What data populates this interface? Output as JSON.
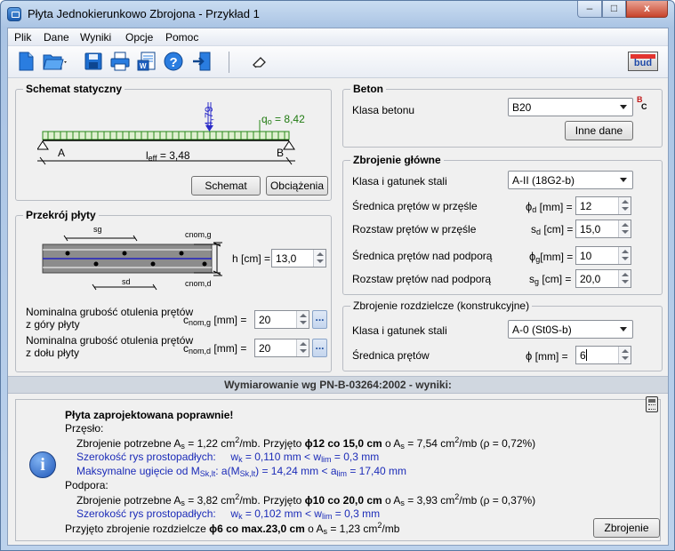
{
  "window": {
    "title": "Płyta Jednokierunkowo Zbrojona - Przykład 1",
    "min": "–",
    "max": "□",
    "close": "x"
  },
  "menu": [
    "Plik",
    "Dane",
    "Wyniki",
    "Opcje",
    "Pomoc"
  ],
  "toolbar": {
    "logo": "bud"
  },
  "schemat": {
    "title": "Schemat statyczny",
    "load_point": "4,79",
    "q0_label": "q",
    "q0_sub": "o",
    "q0_value": "= 8,42",
    "support_a": "A",
    "support_b": "B",
    "leff_label": "l",
    "leff_sub": "eff",
    "leff_value": "= 3,48",
    "btn_schemat": "Schemat",
    "btn_obciazenia": "Obciążenia"
  },
  "przekroj": {
    "title": "Przekrój płyty",
    "sg": "sg",
    "sd": "sd",
    "cnomg": "cnom,g",
    "cnomd": "cnom,d",
    "h_label": "h [cm] =",
    "h_value": "13,0",
    "otul_g_l1": "Nominalna grubość otulenia prętów",
    "otul_g_l2": "z góry płyty",
    "otul_g_sym": "c",
    "otul_g_sub": "nom,g",
    "otul_g_unit": "[mm] =",
    "otul_g_value": "20",
    "otul_d_l1": "Nominalna grubość otulenia prętów",
    "otul_d_l2": "z dołu płyty",
    "otul_d_sym": "c",
    "otul_d_sub": "nom,d",
    "otul_d_unit": "[mm] =",
    "otul_d_value": "20",
    "dots": "..."
  },
  "beton": {
    "title": "Beton",
    "klasa_label": "Klasa betonu",
    "klasa_value": "B20",
    "btn_inne": "Inne dane",
    "icon_b": "B",
    "icon_c": "C"
  },
  "zbrojenie": {
    "title": "Zbrojenie główne",
    "klasa_label": "Klasa i gatunek stali",
    "klasa_value": "A-II (18G2-b)",
    "rows": [
      {
        "label": "Średnica prętów w przęśle",
        "sym": "ϕ",
        "sub": "d",
        "unit": "[mm] =",
        "value": "12"
      },
      {
        "label": "Rozstaw prętów w przęśle",
        "sym": "s",
        "sub": "d",
        "unit": "[cm] =",
        "value": "15,0"
      },
      {
        "label": "Średnica prętów nad podporą",
        "sym": "ϕ",
        "sub": "g",
        "unit": "[mm] =",
        "value": "10"
      },
      {
        "label": "Rozstaw prętów nad podporą",
        "sym": "s",
        "sub": "g",
        "unit": "[cm] =",
        "value": "20,0"
      }
    ]
  },
  "rozdz": {
    "title": "Zbrojenie rozdzielcze (konstrukcyjne)",
    "klasa_label": "Klasa i gatunek stali",
    "klasa_value": "A-0 (St0S-b)",
    "sred_label": "Średnica prętów",
    "sred_sym": "ϕ",
    "sred_unit": "[mm] =",
    "sred_value": "6"
  },
  "results": {
    "header": "Wymiarowanie wg PN-B-03264:2002 - wyniki:",
    "status": "Płyta zaprojektowana poprawnie!",
    "przeslo": "Przęsło:",
    "p1a": "Zbrojenie potrzebne A",
    "p1b": "s",
    "p1c": " = 1,22 cm",
    "p1d": "2",
    "p1e": "/mb.  Przyjęto ",
    "p1f": "ϕ12 co 15,0 cm",
    "p1g": " o A",
    "p1h": "s",
    "p1i": " = 7,54 cm",
    "p1j": "2",
    "p1k": "/mb   (ρ = 0,72%)",
    "p2a": "Szerokość rys prostopadłych:",
    "p2b": "w",
    "p2c": "k",
    "p2d": " = 0,110 mm  <  w",
    "p2e": "lim",
    "p2f": " = 0,3 mm",
    "p3a": "Maksymalne ugięcie od M",
    "p3b": "Sk,lt",
    "p3c": ":    a(M",
    "p3d": "Sk,lt",
    "p3e": ") = 14,24 mm  <  a",
    "p3f": "lim",
    "p3g": " = 17,40 mm",
    "podpora": "Podpora:",
    "s1a": "Zbrojenie potrzebne A",
    "s1b": "s",
    "s1c": " = 3,82 cm",
    "s1d": "2",
    "s1e": "/mb.   Przyjęto  ",
    "s1f": "ϕ10 co 20,0 cm",
    "s1g": " o A",
    "s1h": "s",
    "s1i": " = 3,93 cm",
    "s1j": "2",
    "s1k": "/mb   (ρ = 0,37%)",
    "s2a": "Szerokość rys prostopadłych:",
    "s2b": "w",
    "s2c": "k",
    "s2d": " = 0,102 mm  <  w",
    "s2e": "lim",
    "s2f": " = 0,3 mm",
    "rz_a": "Przyjęto zbrojenie rozdzielcze ",
    "rz_b": "ϕ6 co max.23,0 cm",
    "rz_c": " o A",
    "rz_d": "s",
    "rz_e": " = 1,23 cm",
    "rz_f": "2",
    "rz_g": "/mb",
    "btn_zbrojenie": "Zbrojenie",
    "info_glyph": "i"
  }
}
